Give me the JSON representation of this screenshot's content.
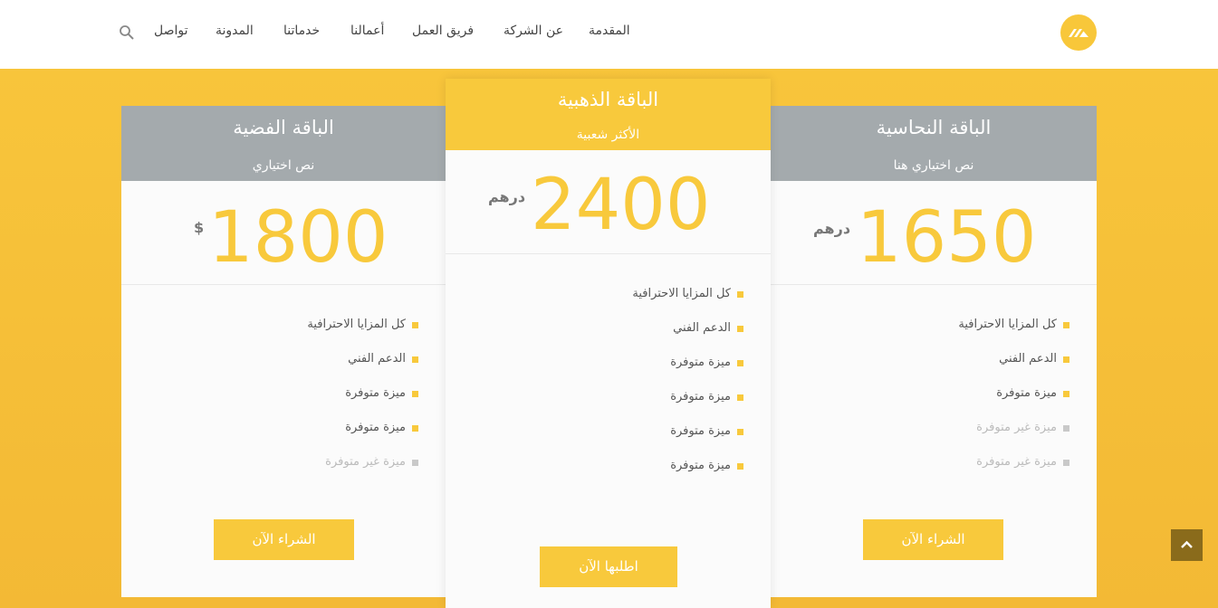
{
  "nav": {
    "items": [
      "المقدمة",
      "عن الشركة",
      "فريق العمل",
      "أعمالنا",
      "خدماتنا",
      "المدونة",
      "تواصل"
    ]
  },
  "icons": {
    "logo": "logo-icon",
    "search": "search-icon",
    "back_to_top": "chevron-up-icon",
    "bullet": "square-bullet-icon"
  },
  "colors": {
    "accent": "#f8c93c",
    "silver_header": "#a4aaad",
    "card_bg": "#fbfbfb",
    "back_to_top": "#8a6b1b"
  },
  "plans": {
    "silver": {
      "title": "الباقة الفضية",
      "subtitle": "نص اختياري",
      "price": "1800",
      "currency": "$",
      "features": [
        {
          "label": "كل المزايا الاحترافية",
          "available": true
        },
        {
          "label": "الدعم الفني",
          "available": true
        },
        {
          "label": "ميزة متوفرة",
          "available": true
        },
        {
          "label": "ميزة متوفرة",
          "available": true
        },
        {
          "label": "ميزة غير متوفرة",
          "available": false
        }
      ],
      "button": "الشراء الآن"
    },
    "gold": {
      "title": "الباقة الذهبية",
      "subtitle": "الأكثر شعبية",
      "price": "2400",
      "currency": "درهم",
      "features": [
        {
          "label": "كل المزايا الاحترافية",
          "available": true
        },
        {
          "label": "الدعم الفني",
          "available": true
        },
        {
          "label": "ميزة متوفرة",
          "available": true
        },
        {
          "label": "ميزة متوفرة",
          "available": true
        },
        {
          "label": "ميزة متوفرة",
          "available": true
        },
        {
          "label": "ميزة متوفرة",
          "available": true
        }
      ],
      "button": "اطلبها الآن"
    },
    "copper": {
      "title": "الباقة النحاسية",
      "subtitle": "نص اختياري هنا",
      "price": "1650",
      "currency": "درهم",
      "features": [
        {
          "label": "كل المزايا الاحترافية",
          "available": true
        },
        {
          "label": "الدعم الفني",
          "available": true
        },
        {
          "label": "ميزة متوفرة",
          "available": true
        },
        {
          "label": "ميزة غير متوفرة",
          "available": false
        },
        {
          "label": "ميزة غير متوفرة",
          "available": false
        }
      ],
      "button": "الشراء الآن"
    }
  }
}
